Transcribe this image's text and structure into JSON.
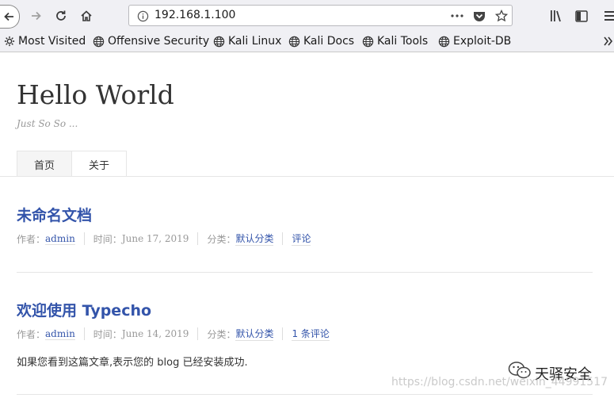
{
  "browser": {
    "url": "192.168.1.100",
    "bookmarks": [
      "Most Visited",
      "Offensive Security",
      "Kali Linux",
      "Kali Docs",
      "Kali Tools",
      "Exploit-DB"
    ]
  },
  "site": {
    "title": "Hello World",
    "description": "Just So So ...",
    "nav": [
      "首页",
      "关于"
    ]
  },
  "posts": [
    {
      "title": "未命名文档",
      "author_label": "作者：",
      "author": "admin",
      "time_label": "时间：",
      "date": "June 17, 2019",
      "category_label": "分类：",
      "category": "默认分类",
      "comments": "评论"
    },
    {
      "title": "欢迎使用 Typecho",
      "author_label": "作者：",
      "author": "admin",
      "time_label": "时间：",
      "date": "June 14, 2019",
      "category_label": "分类：",
      "category": "默认分类",
      "comments": "1 条评论",
      "excerpt": "如果您看到这篇文章,表示您的 blog 已经安装成功."
    }
  ],
  "watermark": {
    "name": "天驿安全",
    "url": "https://blog.csdn.net/weixin_44991517"
  }
}
